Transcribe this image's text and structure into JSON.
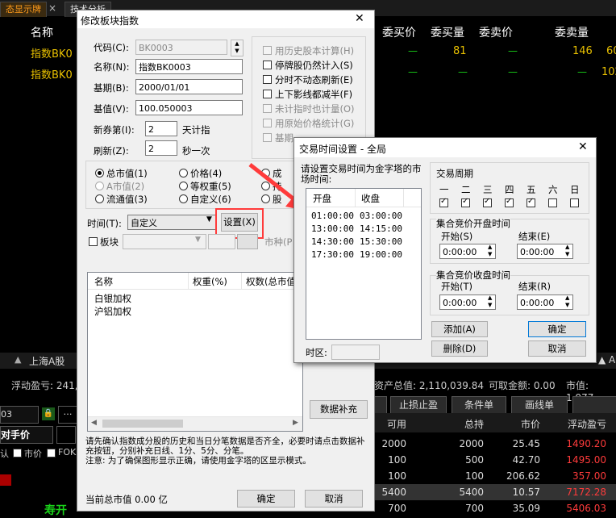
{
  "bg": {
    "tabs": [
      "态显示牌",
      "技术分析"
    ],
    "columns": [
      "名称",
      "委买价",
      "委买量",
      "委卖价",
      "委卖量"
    ],
    "rows": [
      {
        "name": "指数BK0",
        "bid": "—",
        "bid_qty": "81",
        "ask": "—",
        "ask_qty": "146",
        "extra": "60"
      },
      {
        "name": "指数BK0",
        "bid": "—",
        "bid_qty": "—",
        "ask": "—",
        "ask_qty": "—",
        "extra": "102"
      }
    ],
    "market_tab": "上海A股",
    "right_tab": "▲ A",
    "float_pl": "浮动盈亏: 241,0",
    "total_assets": "资产总值: 2,110,039.84",
    "available": "可取金额: 0.00",
    "market_value": "市值: 1,977,",
    "buttons": [
      "止损止盈",
      "条件单",
      "画线单"
    ],
    "code_val": "03",
    "price_label": "对手价",
    "checks": [
      "认",
      "市价",
      "FOK"
    ],
    "table_headers": [
      "可用",
      "总持",
      "市价",
      "浮动盈亏"
    ],
    "table_rows": [
      [
        "2000",
        "2000",
        "25.45",
        "1490.20"
      ],
      [
        "100",
        "500",
        "42.70",
        "1495.00"
      ],
      [
        "100",
        "100",
        "206.62",
        "357.00"
      ],
      [
        "5400",
        "5400",
        "10.57",
        "7172.28"
      ],
      [
        "700",
        "700",
        "35.09",
        "5406.03"
      ]
    ],
    "bottom_text": "寿开",
    "colors": {
      "accent": "#ff9b1a",
      "yellow": "#e8c000",
      "green": "#19d219",
      "red": "#ff3b3b"
    }
  },
  "dlg1": {
    "title": "修改板块指数",
    "code_label": "代码(C):",
    "code_value": "BK0003",
    "name_label": "名称(N):",
    "name_value": "指数BK0003",
    "base_date_label": "基期(B):",
    "base_date_value": "2000/01/01",
    "base_value_label": "基值(V):",
    "base_value_value": "100.050003",
    "new_stock_label": "新券第(I):",
    "new_stock_value": "2",
    "new_stock_unit": "天计指",
    "refresh_label": "刷新(Z):",
    "refresh_value": "2",
    "refresh_unit": "秒一次",
    "options": [
      {
        "label": "用历史股本计算(H)",
        "checked": false,
        "disabled": true
      },
      {
        "label": "停牌股仍然计入(S)",
        "checked": false,
        "disabled": false
      },
      {
        "label": "分时不动态刷新(E)",
        "checked": false,
        "disabled": false
      },
      {
        "label": "上下影线都减半(F)",
        "checked": false,
        "disabled": false
      },
      {
        "label": "未计指时也计量(O)",
        "checked": false,
        "disabled": true
      },
      {
        "label": "用原始价格统计(G)",
        "checked": false,
        "disabled": true
      },
      {
        "label": "基期",
        "checked": false,
        "disabled": true
      }
    ],
    "weights_col1": [
      {
        "label": "总市值(1)",
        "on": true,
        "disabled": false
      },
      {
        "label": "A市值(2)",
        "on": false,
        "disabled": true
      },
      {
        "label": "流通值(3)",
        "on": false,
        "disabled": false
      }
    ],
    "weights_col2": [
      {
        "label": "价格(4)",
        "on": false,
        "disabled": false
      },
      {
        "label": "等权重(5)",
        "on": false,
        "disabled": false
      },
      {
        "label": "自定义(6)",
        "on": false,
        "disabled": false
      }
    ],
    "weights_col3": [
      "成",
      "持",
      "股"
    ],
    "time_label": "时间(T):",
    "time_value": "自定义",
    "settings_button": "设置(X)",
    "block_label": "板块",
    "market_label": "市种(P",
    "list_headers": [
      "名称",
      "权重(%)",
      "权数(总市值"
    ],
    "list_items": [
      "白银加权",
      "沪铝加权"
    ],
    "data_fill_button": "数据补充",
    "note1": "请先确认指数成分股的历史和当日分笔数据是否齐全，必要时请点击数据补充按钮，分别补充日线、1分、5分、分笔。",
    "note2": "注意: 为了确保图形显示正确，请使用金字塔的区显示模式。",
    "total_label": "当前总市值 0.00 亿",
    "ok": "确定",
    "cancel": "取消",
    "close": "✕"
  },
  "dlg2": {
    "title": "交易时间设置 - 全局",
    "close": "✕",
    "prompt": "请设置交易时间为金字塔的市场时间:",
    "col_open": "开盘",
    "col_close": "收盘",
    "sessions": [
      {
        "open": "01:00:00",
        "close": "03:00:00"
      },
      {
        "open": "13:00:00",
        "close": "14:15:00"
      },
      {
        "open": "14:30:00",
        "close": "15:30:00"
      },
      {
        "open": "17:30:00",
        "close": "19:00:00"
      }
    ],
    "week_label": "交易周期",
    "weekdays": [
      {
        "label": "一",
        "checked": true
      },
      {
        "label": "二",
        "checked": true
      },
      {
        "label": "三",
        "checked": true
      },
      {
        "label": "四",
        "checked": true
      },
      {
        "label": "五",
        "checked": true
      },
      {
        "label": "六",
        "checked": false
      },
      {
        "label": "日",
        "checked": false
      }
    ],
    "open_auction_label": "集合竞价开盘时间",
    "close_auction_label": "集合竞价收盘时间",
    "start_label_open": "开始(S)",
    "end_label_open": "结束(E)",
    "start_label_close": "开始(T)",
    "end_label_close": "结束(R)",
    "auction_open_start": "0:00:00",
    "auction_open_end": "0:00:00",
    "auction_close_start": "0:00:00",
    "auction_close_end": "0:00:00",
    "tz_label": "时区:",
    "add": "添加(A)",
    "delete": "删除(D)",
    "ok": "确定",
    "cancel": "取消"
  }
}
